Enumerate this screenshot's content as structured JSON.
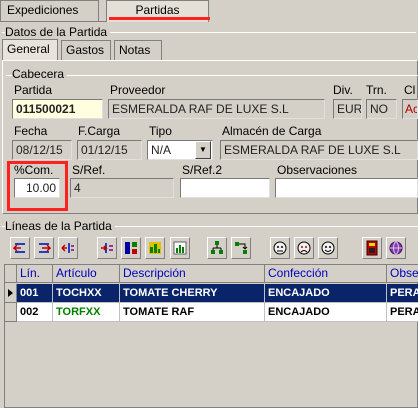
{
  "tabs": {
    "expediciones": "Expediciones",
    "partidas": "Partidas"
  },
  "datos": {
    "section_title": "Datos de la Partida",
    "subtabs": [
      "General",
      "Gastos",
      "Notas"
    ]
  },
  "cabecera": {
    "title": "Cabecera",
    "labels": {
      "partida": "Partida",
      "proveedor": "Proveedor",
      "div": "Div.",
      "trn": "Trn.",
      "cl": "Cl",
      "fecha": "Fecha",
      "fcarga": "F.Carga",
      "tipo": "Tipo",
      "almacen": "Almacén de Carga",
      "pcom": "%Com.",
      "sref": "S/Ref.",
      "sref2": "S/Ref.2",
      "observaciones": "Observaciones"
    },
    "values": {
      "partida": "011500021",
      "proveedor": "ESMERALDA RAF DE LUXE S.L",
      "div": "EUR",
      "trn": "NO",
      "cl": "Ac",
      "fecha": "08/12/15",
      "fcarga": "01/12/15",
      "tipo": "N/A",
      "almacen": "ESMERALDA RAF DE LUXE S.L",
      "pcom": "10.00",
      "sref": "4",
      "sref2": "",
      "observaciones": ""
    }
  },
  "lineas": {
    "title": "Líneas de la Partida",
    "columns": [
      "Lín.",
      "Artículo",
      "Descripción",
      "Confección",
      "Obse"
    ],
    "rows": [
      {
        "lin": "001",
        "articulo": "TOCHXX",
        "descripcion": "TOMATE CHERRY",
        "confeccion": "ENCAJADO",
        "obs": "PERA"
      },
      {
        "lin": "002",
        "articulo": "TORFXX",
        "descripcion": "TOMATE RAF",
        "confeccion": "ENCAJADO",
        "obs": "PERA"
      }
    ]
  },
  "toolbar_icons": [
    "move-left-icon",
    "move-right-icon",
    "insert-left-icon",
    "insert-right-icon",
    "split-icon",
    "chart-icon",
    "group-icon",
    "reorder-icon",
    "face-a-icon",
    "face-b-icon",
    "face-c-icon",
    "calculator-icon",
    "globe-icon"
  ],
  "colors": {
    "highlight": "#ff2020",
    "selection": "#0a246a",
    "green_text": "#008000"
  }
}
